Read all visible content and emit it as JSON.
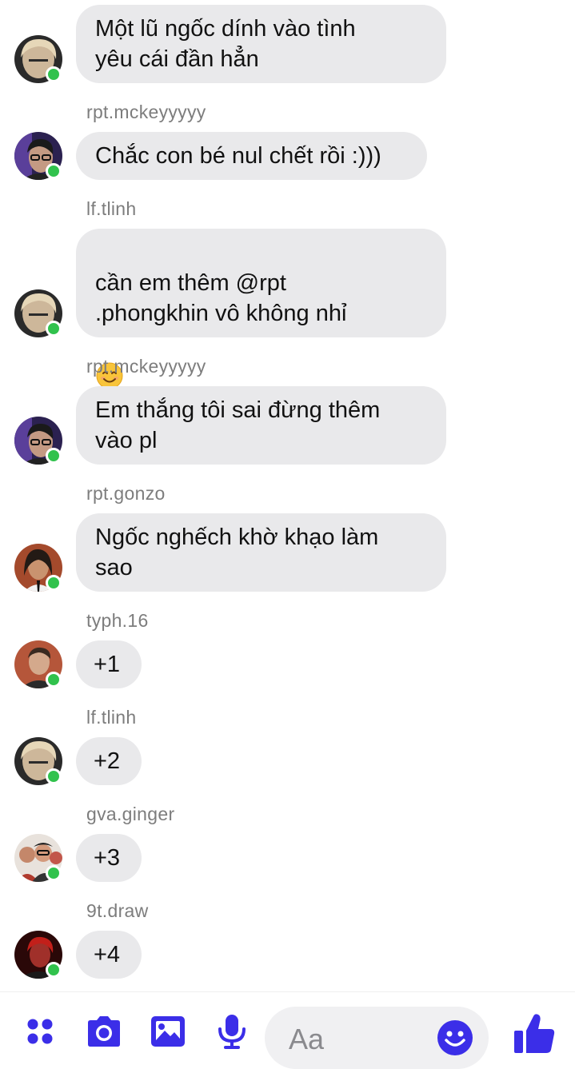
{
  "messages": [
    {
      "sender": "",
      "text": "Một lũ ngốc dính vào tình\nyêu cái đần hẳn",
      "avatar_icon": "avatar-blonde"
    },
    {
      "sender": "rpt.mckeyyyyy",
      "text": "Chắc con bé nul chết rồi :)))",
      "avatar_icon": "avatar-glasses"
    },
    {
      "sender": "lf.tlinh",
      "text": "cần em thêm @rpt\n.phongkhin vô không nhỉ",
      "emoji": "smiling-face",
      "avatar_icon": "avatar-blonde"
    },
    {
      "sender": "rpt.mckeyyyyy",
      "text": "Em thắng tôi sai đừng thêm\nvào pl",
      "avatar_icon": "avatar-glasses"
    },
    {
      "sender": "rpt.gonzo",
      "text": "Ngốc nghếch khờ khạo làm\nsao",
      "avatar_icon": "avatar-longhair"
    },
    {
      "sender": "typh.16",
      "text": "+1",
      "avatar_icon": "avatar-orange"
    },
    {
      "sender": "lf.tlinh",
      "text": "+2",
      "avatar_icon": "avatar-blonde"
    },
    {
      "sender": "gva.ginger",
      "text": "+3",
      "avatar_icon": "avatar-group"
    },
    {
      "sender": "9t.draw",
      "text": "+4",
      "avatar_icon": "avatar-red"
    }
  ],
  "composer": {
    "placeholder": "Aa",
    "tools": [
      "apps-icon",
      "camera-icon",
      "gallery-icon",
      "microphone-icon"
    ],
    "emoji_button": "emoji-icon",
    "like_button": "thumbs-up-icon"
  },
  "colors": {
    "accent": "#3b2ee8",
    "bubble": "#e9e9eb",
    "online": "#31c24d",
    "sender_text": "#7d7d7d"
  }
}
